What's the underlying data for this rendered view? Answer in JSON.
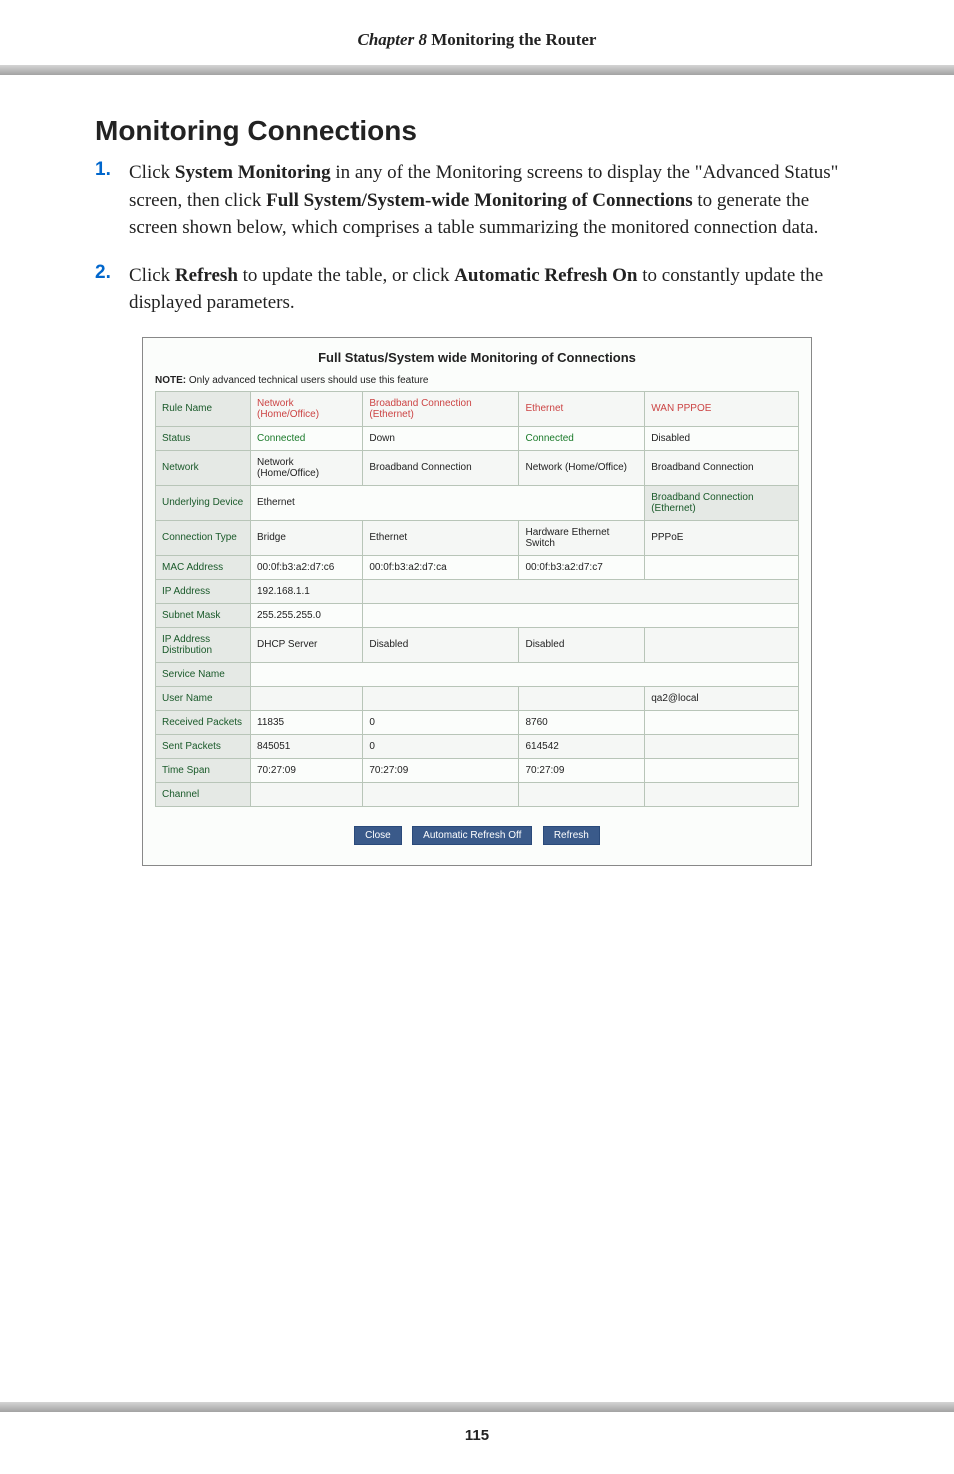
{
  "header": {
    "chapter": "Chapter 8",
    "title": "  Monitoring the Router"
  },
  "heading": "Monitoring Connections",
  "step1": {
    "num": "1.",
    "text_parts": {
      "p1": "Click ",
      "b1": "System Monitoring",
      "p2": " in any of the Monitoring screens to display the \"Advanced Status\" screen, then click ",
      "b2": "Full System/System-wide Monitoring of Connections",
      "p3": " to generate the screen shown below,  which comprises a table summarizing the monitored connection data."
    }
  },
  "step2": {
    "num": "2.",
    "text_parts": {
      "p1": "Click ",
      "b1": "Refresh",
      "p2": " to update the table, or click ",
      "b2": "Automatic Refresh On",
      "p3": " to constantly update the displayed parameters."
    }
  },
  "screenshot": {
    "title": "Full Status/System wide Monitoring of Connections",
    "note_label": "NOTE:",
    "note_text": " Only advanced technical users should use this feature",
    "rows": [
      {
        "label": "Rule Name",
        "c1": "Network (Home/Office)",
        "c2": "Broadband Connection (Ethernet)",
        "c3": "Ethernet",
        "c4": "WAN PPPOE",
        "link": true
      },
      {
        "label": "Status",
        "c1": "Connected",
        "c2": "Down",
        "c3": "Connected",
        "c4": "Disabled",
        "greenc1": true,
        "greenc3": true
      },
      {
        "label": "Network",
        "c1": "Network (Home/Office)",
        "c2": "Broadband Connection",
        "c3": "Network (Home/Office)",
        "c4": "Broadband Connection"
      },
      {
        "label": "Underlying Device",
        "c1": "Ethernet",
        "c2": "",
        "c3": "",
        "c4": "Broadband Connection (Ethernet)",
        "span23": true,
        "greenc4": true
      },
      {
        "label": "Connection Type",
        "c1": "Bridge",
        "c2": "Ethernet",
        "c3": "Hardware Ethernet Switch",
        "c4": "PPPoE"
      },
      {
        "label": "MAC Address",
        "c1": "00:0f:b3:a2:d7:c6",
        "c2": "00:0f:b3:a2:d7:ca",
        "c3": "00:0f:b3:a2:d7:c7",
        "c4": ""
      },
      {
        "label": "IP Address",
        "c1": "192.168.1.1",
        "c2": "",
        "c3": "",
        "c4": "",
        "span234": true
      },
      {
        "label": "Subnet Mask",
        "c1": "255.255.255.0",
        "c2": "",
        "c3": "",
        "c4": "",
        "span234": true
      },
      {
        "label": "IP Address Distribution",
        "c1": "DHCP Server",
        "c2": "Disabled",
        "c3": "Disabled",
        "c4": ""
      },
      {
        "label": "Service Name",
        "c1": "",
        "c2": "",
        "c3": "",
        "c4": "",
        "spanAll": true
      },
      {
        "label": "User Name",
        "c1": "",
        "c2": "",
        "c3": "",
        "c4": "qa2@local"
      },
      {
        "label": "Received Packets",
        "c1": "11835",
        "c2": "0",
        "c3": "8760",
        "c4": ""
      },
      {
        "label": "Sent Packets",
        "c1": "845051",
        "c2": "0",
        "c3": "614542",
        "c4": ""
      },
      {
        "label": "Time Span",
        "c1": "70:27:09",
        "c2": "70:27:09",
        "c3": "70:27:09",
        "c4": ""
      },
      {
        "label": "Channel",
        "c1": "",
        "c2": "",
        "c3": "",
        "c4": ""
      }
    ],
    "buttons": {
      "close": "Close",
      "auto_refresh": "Automatic Refresh Off",
      "refresh": "Refresh"
    }
  },
  "page_number": "115"
}
